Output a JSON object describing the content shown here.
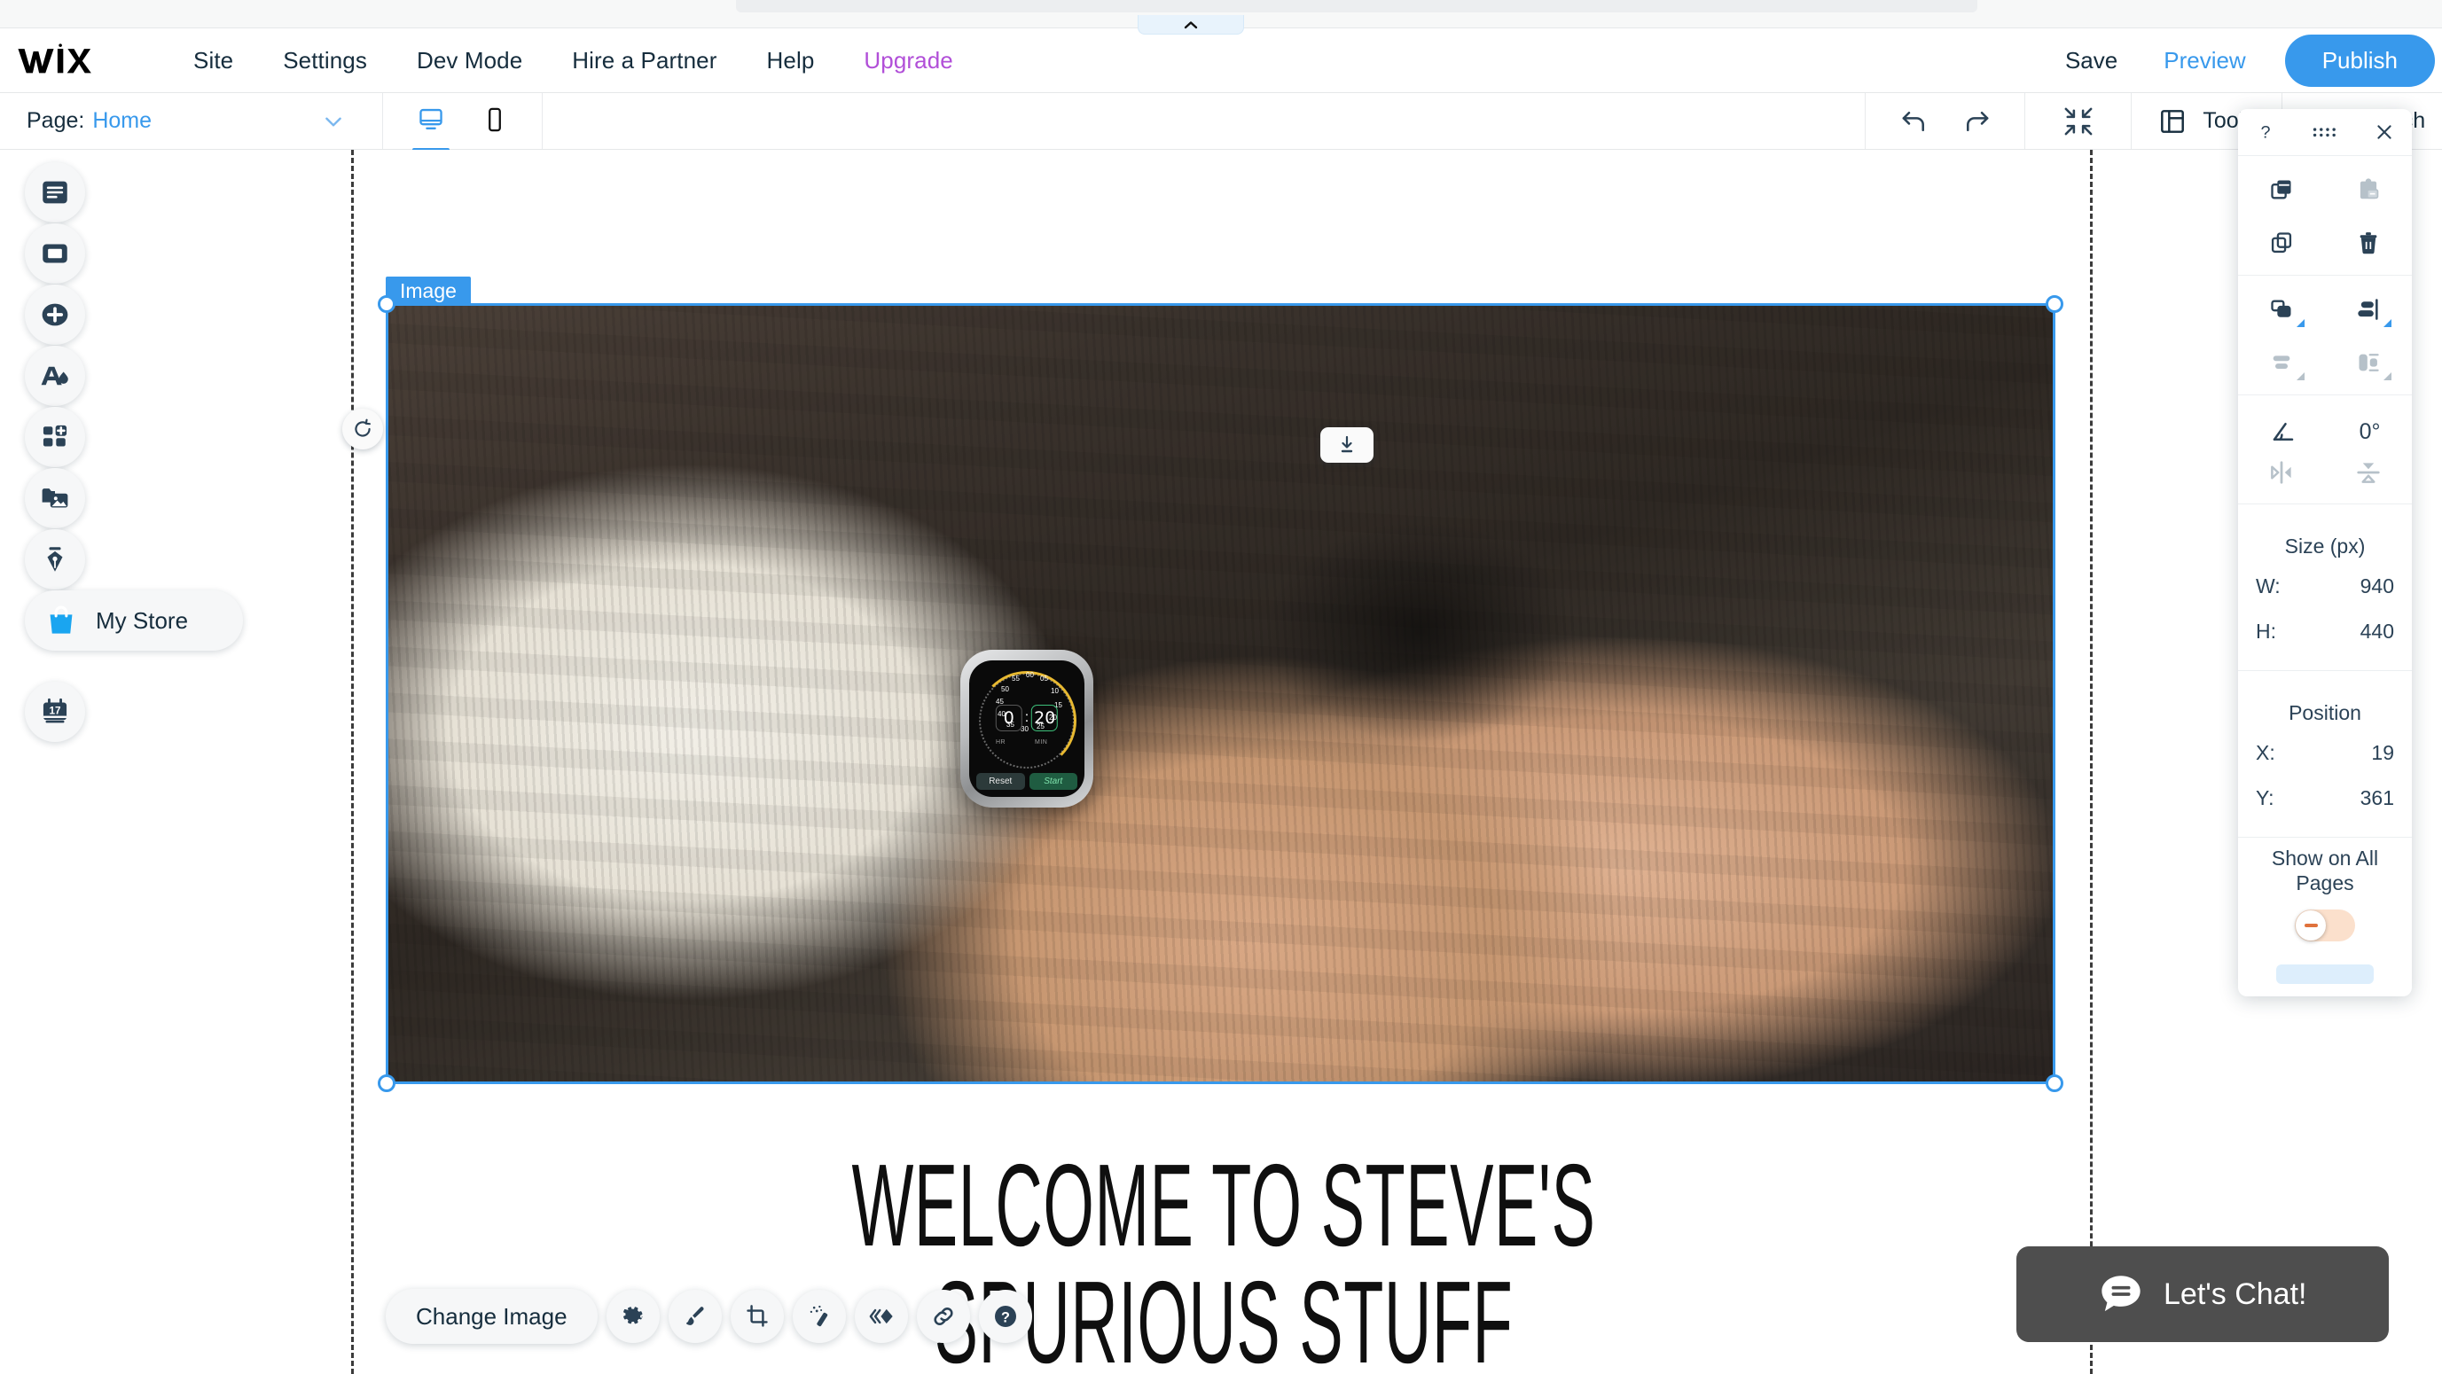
{
  "app": {
    "brand_logo": "wix-logo",
    "accent_blue": "#3899ec",
    "upgrade_purple": "#b14fd8"
  },
  "menubar": {
    "items": [
      {
        "label": "Site",
        "name": "menu-site"
      },
      {
        "label": "Settings",
        "name": "menu-settings"
      },
      {
        "label": "Dev Mode",
        "name": "menu-dev-mode"
      },
      {
        "label": "Hire a Partner",
        "name": "menu-hire-a-partner"
      },
      {
        "label": "Help",
        "name": "menu-help"
      },
      {
        "label": "Upgrade",
        "name": "menu-upgrade"
      }
    ],
    "save_label": "Save",
    "preview_label": "Preview",
    "publish_label": "Publish"
  },
  "toolbar": {
    "page_label": "Page:",
    "page_value": "Home",
    "chevron_icon": "chevron-down-icon",
    "desktop_icon": "desktop-icon",
    "mobile_icon": "mobile-icon",
    "undo_icon": "undo-icon",
    "redo_icon": "redo-icon",
    "zoom_out_icon": "zoom-out-icon",
    "tools_icon": "panels-icon",
    "tools_label": "Tools",
    "search_icon": "search-icon",
    "search_label": "Search"
  },
  "sidebar": {
    "items": [
      {
        "name": "sidebar-item-menus-and-pages",
        "icon": "pages-icon",
        "label": ""
      },
      {
        "name": "sidebar-item-background",
        "icon": "background-icon",
        "label": ""
      },
      {
        "name": "sidebar-item-add",
        "icon": "plus-circle-icon",
        "label": ""
      },
      {
        "name": "sidebar-item-design",
        "icon": "theme-droplet-icon",
        "label": ""
      },
      {
        "name": "sidebar-item-add-apps",
        "icon": "apps-add-icon",
        "label": ""
      },
      {
        "name": "sidebar-item-my-uploads",
        "icon": "media-folder-icon",
        "label": ""
      },
      {
        "name": "sidebar-item-blog",
        "icon": "pen-nib-icon",
        "label": ""
      },
      {
        "name": "sidebar-item-my-store",
        "icon": "shopping-bag-icon",
        "label": "My Store"
      },
      {
        "name": "sidebar-item-bookings",
        "icon": "calendar-17-icon",
        "label": ""
      }
    ]
  },
  "canvas": {
    "selection_badge": "Image",
    "rotate_icon": "rotate-icon",
    "download_icon": "download-icon",
    "hero_heading_line1": "WELCOME TO STEVE'S",
    "hero_heading_line2": "SPURIOUS STUFF",
    "watch": {
      "hours": "0",
      "minutes": "20",
      "hour_unit": "HR",
      "minute_unit": "MIN",
      "reset_label": "Reset",
      "start_label": "Start",
      "dial_ticks": [
        "00",
        "05",
        "10",
        "15",
        "20",
        "25",
        "30",
        "35",
        "40",
        "45",
        "50",
        "55"
      ]
    }
  },
  "image_toolbar": {
    "change_image_label": "Change Image",
    "buttons": [
      {
        "name": "image-settings-button",
        "icon": "gear-icon"
      },
      {
        "name": "image-design-button",
        "icon": "paintbrush-icon"
      },
      {
        "name": "image-crop-button",
        "icon": "crop-icon"
      },
      {
        "name": "image-effects-button",
        "icon": "magic-wand-icon"
      },
      {
        "name": "image-animation-button",
        "icon": "animation-icon"
      },
      {
        "name": "image-link-button",
        "icon": "link-icon"
      },
      {
        "name": "image-help-button",
        "icon": "help-circle-icon"
      }
    ]
  },
  "right_panel": {
    "help_icon": "question-mark-icon",
    "drag_icon": "drag-dots-icon",
    "close_icon": "close-icon",
    "clipboard": [
      {
        "name": "copy-button",
        "icon": "copy-style-icon"
      },
      {
        "name": "paste-button",
        "icon": "paste-icon"
      },
      {
        "name": "duplicate-button",
        "icon": "duplicate-icon"
      },
      {
        "name": "delete-button",
        "icon": "trash-icon"
      }
    ],
    "arrange": [
      {
        "name": "arrange-layers-button",
        "icon": "layers-icon"
      },
      {
        "name": "align-button",
        "icon": "align-right-icon"
      },
      {
        "name": "distribute-button",
        "icon": "distribute-icon"
      },
      {
        "name": "match-size-button",
        "icon": "match-size-icon"
      }
    ],
    "rotation_icon": "angle-icon",
    "rotation_value": "0°",
    "flip_horizontal_icon": "flip-horizontal-icon",
    "flip_vertical_icon": "flip-vertical-icon",
    "size_title": "Size (px)",
    "width_key": "W:",
    "width_value": "940",
    "height_key": "H:",
    "height_value": "440",
    "position_title": "Position",
    "x_key": "X:",
    "x_value": "19",
    "y_key": "Y:",
    "y_value": "361",
    "show_on_all_pages_label": "Show on All Pages",
    "show_on_all_pages_state": "off"
  },
  "chat_widget": {
    "icon": "chat-bubble-icon",
    "label": "Let's Chat!"
  }
}
